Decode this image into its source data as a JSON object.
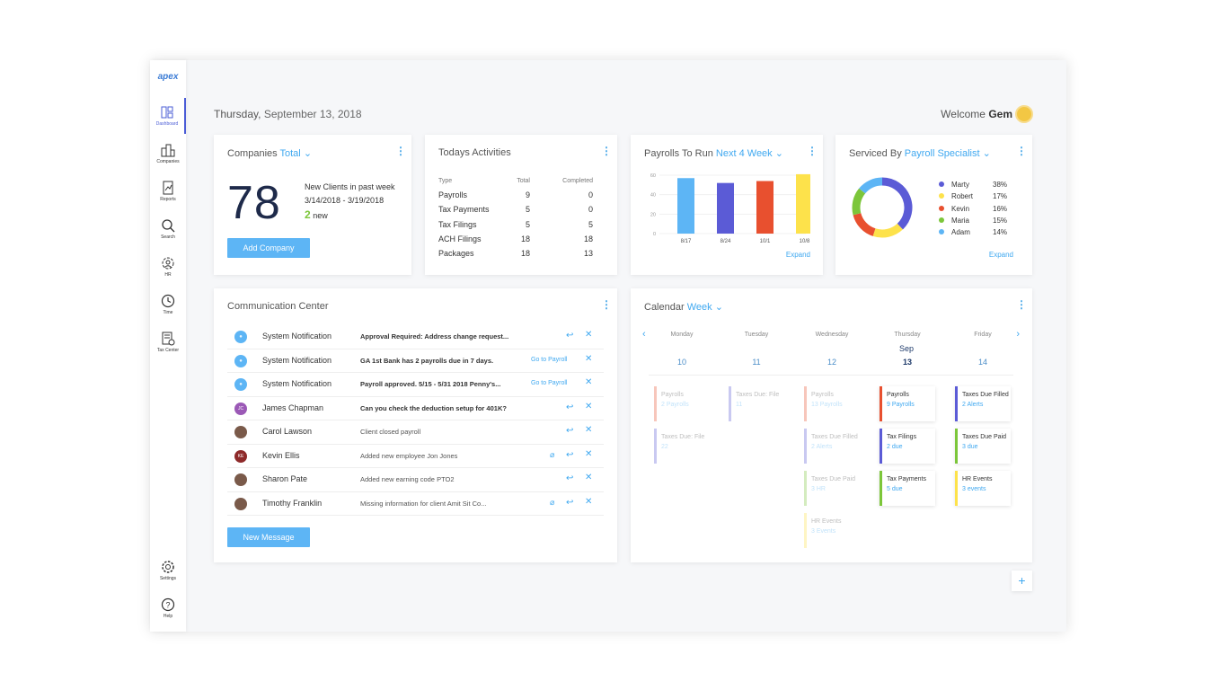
{
  "brand": {
    "logo": "apex"
  },
  "nav": {
    "items": [
      {
        "label": "Dashboard",
        "icon": "dashboard-icon"
      },
      {
        "label": "Companies",
        "icon": "companies-icon"
      },
      {
        "label": "Reports",
        "icon": "reports-icon"
      },
      {
        "label": "Search",
        "icon": "search-icon"
      },
      {
        "label": "HR",
        "icon": "hr-icon"
      },
      {
        "label": "Time",
        "icon": "clock-icon"
      },
      {
        "label": "Tax Center",
        "icon": "tax-center-icon"
      }
    ],
    "bottom": [
      {
        "label": "Settings",
        "icon": "gear-icon"
      },
      {
        "label": "Help",
        "icon": "help-icon"
      }
    ]
  },
  "header": {
    "day": "Thursday,",
    "date": "September 13, 2018",
    "welcome": "Welcome",
    "user": "Gem"
  },
  "companies": {
    "title": "Companies",
    "filter": "Total",
    "count": "78",
    "new_clients_label": "New Clients in past week",
    "range": "3/14/2018 - 3/19/2018",
    "new_count": "2",
    "new_label": "new",
    "button": "Add Company"
  },
  "activities": {
    "title": "Todays Activities",
    "headers": [
      "Type",
      "Total",
      "Completed"
    ],
    "rows": [
      {
        "type": "Payrolls",
        "total": "9",
        "completed": "0",
        "status": "red"
      },
      {
        "type": "Tax Payments",
        "total": "5",
        "completed": "0",
        "status": "red"
      },
      {
        "type": "Tax Filings",
        "total": "5",
        "completed": "5",
        "status": "green"
      },
      {
        "type": "ACH Filings",
        "total": "18",
        "completed": "18",
        "status": "green"
      },
      {
        "type": "Packages",
        "total": "18",
        "completed": "13",
        "status": "neutral"
      }
    ]
  },
  "payrolls": {
    "title": "Payrolls To Run",
    "filter": "Next 4 Week",
    "expand": "Expand"
  },
  "serviced": {
    "title": "Serviced By",
    "filter": "Payroll Specialist",
    "expand": "Expand"
  },
  "chart_data": [
    {
      "type": "bar",
      "categories": [
        "8/17",
        "8/24",
        "10/1",
        "10/8"
      ],
      "values": [
        57,
        52,
        54,
        61
      ],
      "ylim": [
        0,
        60
      ],
      "yticks": [
        "0",
        "20",
        "40",
        "60"
      ],
      "colors": [
        "#5db5f5",
        "#5b5bd6",
        "#e8502f",
        "#fde24b"
      ],
      "grid": true
    },
    {
      "type": "pie",
      "categories": [
        "Marty",
        "Robert",
        "Kevin",
        "Maria",
        "Adam"
      ],
      "values": [
        38,
        17,
        16,
        15,
        14
      ],
      "labels": [
        "38%",
        "17%",
        "16%",
        "15%",
        "14%"
      ],
      "colors": [
        "#5b5bd6",
        "#fde24b",
        "#e8502f",
        "#7cc63a",
        "#5db5f5"
      ]
    }
  ],
  "communication": {
    "title": "Communication Center",
    "button": "New Message",
    "messages": [
      {
        "sender": "System Notification",
        "text": "Approval Required: Address change request...",
        "bold": true,
        "avatar": "system",
        "action": ""
      },
      {
        "sender": "System Notification",
        "text": "GA 1st Bank has 2 payrolls due in 7 days.",
        "bold": true,
        "avatar": "system",
        "action": "Go to Payroll"
      },
      {
        "sender": "System Notification",
        "text": "Payroll approved. 5/15 - 5/31 2018 Penny's...",
        "bold": true,
        "avatar": "system",
        "action": "Go to Payroll"
      },
      {
        "sender": "James Chapman",
        "text": "Can you check the deduction setup for 401K?",
        "bold": true,
        "avatar": "JC",
        "action": ""
      },
      {
        "sender": "Carol Lawson",
        "text": "Client closed payroll",
        "bold": false,
        "avatar": "photo",
        "action": ""
      },
      {
        "sender": "Kevin Ellis",
        "text": "Added new employee Jon Jones",
        "bold": false,
        "avatar": "KE",
        "action": "",
        "attachment": true
      },
      {
        "sender": "Sharon Pate",
        "text": "Added new earning code PTO2",
        "bold": false,
        "avatar": "photo",
        "action": ""
      },
      {
        "sender": "Timothy Franklin",
        "text": "Missing information for client Amit Sit Co...",
        "bold": false,
        "avatar": "photo",
        "action": "",
        "attachment": true
      }
    ]
  },
  "calendar": {
    "title": "Calendar",
    "filter": "Week",
    "month": "Sep",
    "days": [
      {
        "name": "Monday",
        "num": "10"
      },
      {
        "name": "Tuesday",
        "num": "11"
      },
      {
        "name": "Wednesday",
        "num": "12"
      },
      {
        "name": "Thursday",
        "num": "13"
      },
      {
        "name": "Friday",
        "num": "14"
      }
    ],
    "events": [
      {
        "day": 0,
        "slot": 0,
        "title": "Payrolls",
        "sub": "2 Payrolls",
        "color": "#e8502f",
        "faded": true
      },
      {
        "day": 0,
        "slot": 1,
        "title": "Taxes Due: File",
        "sub": "22",
        "color": "#5b5bd6",
        "faded": true
      },
      {
        "day": 1,
        "slot": 0,
        "title": "Taxes Due: File",
        "sub": "11",
        "color": "#5b5bd6",
        "faded": true
      },
      {
        "day": 2,
        "slot": 0,
        "title": "Payrolls",
        "sub": "13 Payrolls",
        "color": "#e8502f",
        "faded": true
      },
      {
        "day": 2,
        "slot": 1,
        "title": "Taxes Due Filled",
        "sub": "2 Alerts",
        "color": "#5b5bd6",
        "faded": true
      },
      {
        "day": 2,
        "slot": 2,
        "title": "Taxes Due Paid",
        "sub": "3 HR",
        "color": "#7cc63a",
        "faded": true
      },
      {
        "day": 2,
        "slot": 3,
        "title": "HR Events",
        "sub": "3 Events",
        "color": "#fde24b",
        "faded": true
      },
      {
        "day": 3,
        "slot": 0,
        "title": "Payrolls",
        "sub": "9 Payrolls",
        "color": "#e8502f",
        "faded": false
      },
      {
        "day": 3,
        "slot": 1,
        "title": "Tax Filings",
        "sub": "2 due",
        "color": "#5b5bd6",
        "faded": false
      },
      {
        "day": 3,
        "slot": 2,
        "title": "Tax Payments",
        "sub": "5 due",
        "color": "#7cc63a",
        "faded": false
      },
      {
        "day": 4,
        "slot": 0,
        "title": "Taxes Due Filled",
        "sub": "2 Alerts",
        "color": "#5b5bd6",
        "faded": false
      },
      {
        "day": 4,
        "slot": 1,
        "title": "Taxes Due Paid",
        "sub": "3 due",
        "color": "#7cc63a",
        "faded": false
      },
      {
        "day": 4,
        "slot": 2,
        "title": "HR Events",
        "sub": "3 events",
        "color": "#fde24b",
        "faded": false
      }
    ]
  },
  "fab": {
    "label": "+"
  }
}
